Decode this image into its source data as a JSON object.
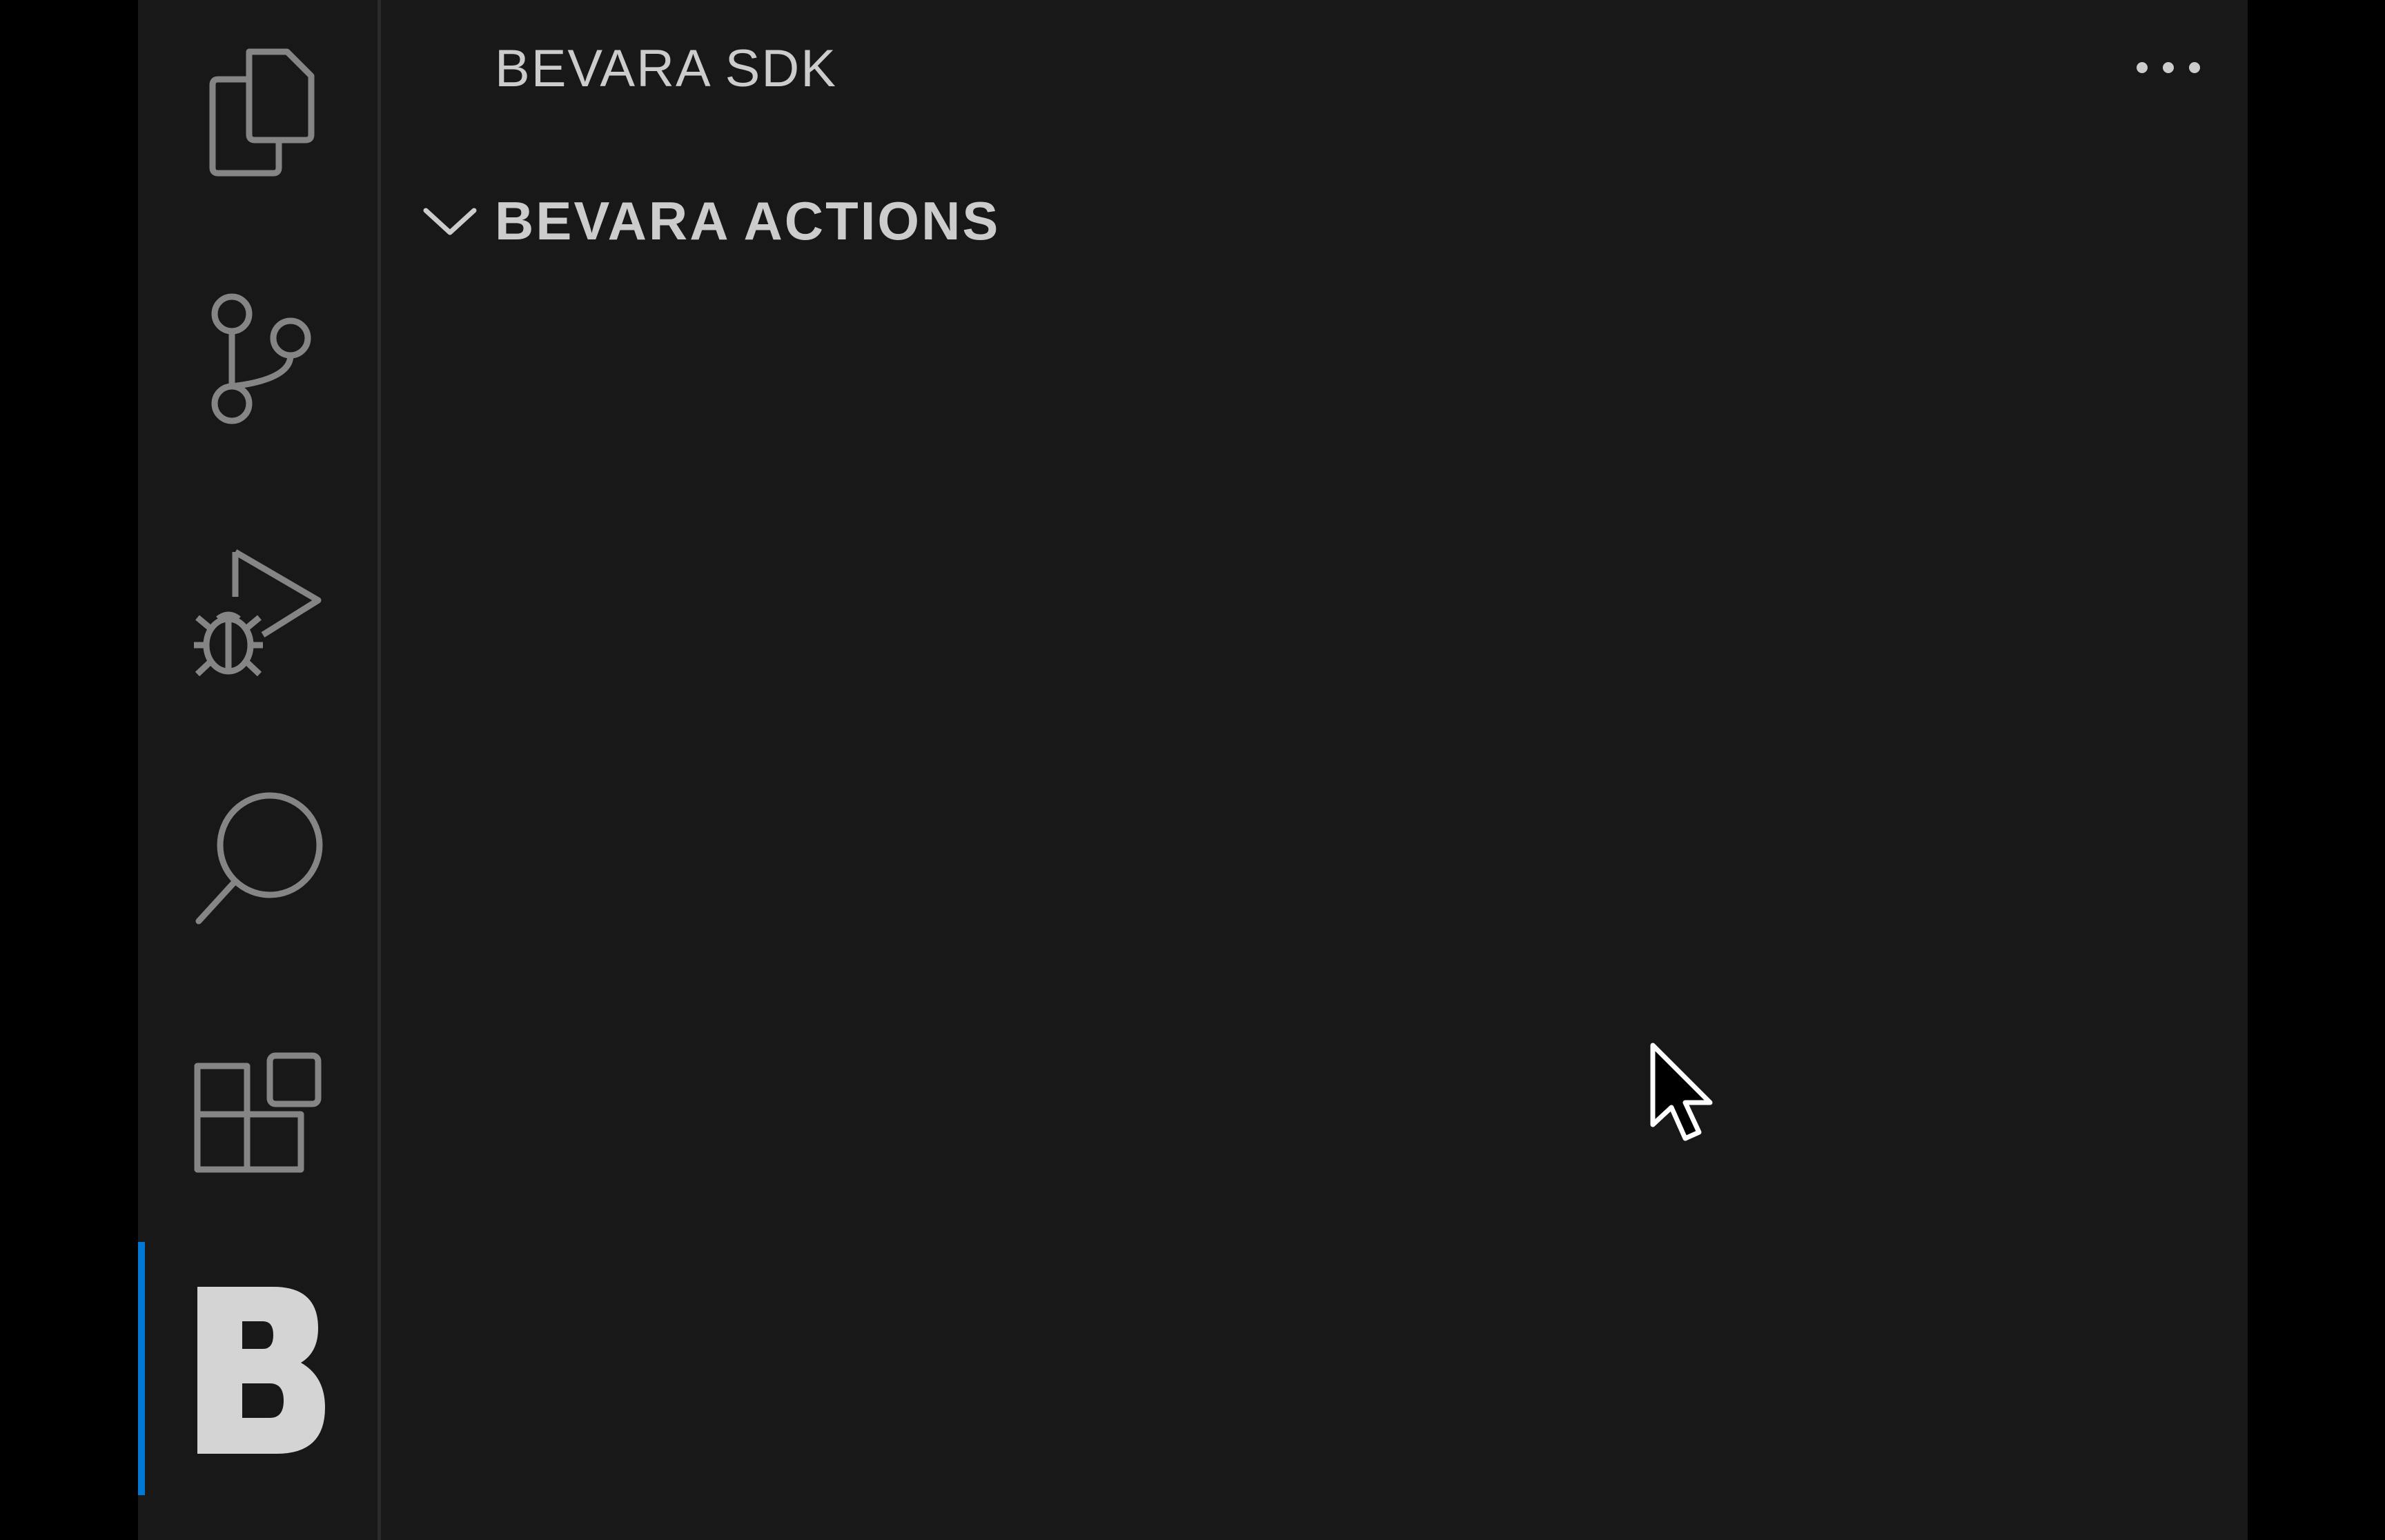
{
  "sidebar": {
    "title": "BEVARA SDK",
    "more_actions_icon": "ellipsis-icon"
  },
  "section": {
    "title": "BEVARA ACTIONS",
    "expanded": true,
    "chevron_icon": "chevron-down-icon"
  },
  "activity_bar": {
    "items": [
      {
        "name": "explorer",
        "icon": "files-icon"
      },
      {
        "name": "source-control",
        "icon": "source-control-icon"
      },
      {
        "name": "run-and-debug",
        "icon": "run-debug-icon"
      },
      {
        "name": "search",
        "icon": "search-icon"
      },
      {
        "name": "extensions",
        "icon": "extensions-icon"
      },
      {
        "name": "bevara",
        "icon": "bevara-logo-icon",
        "active": true
      }
    ]
  },
  "colors": {
    "background": "#181818",
    "outer_background": "#000000",
    "icon": "#858585",
    "text": "#cccccc",
    "active_accent": "#0078d4",
    "bevara_logo": "#d4d4d4"
  }
}
